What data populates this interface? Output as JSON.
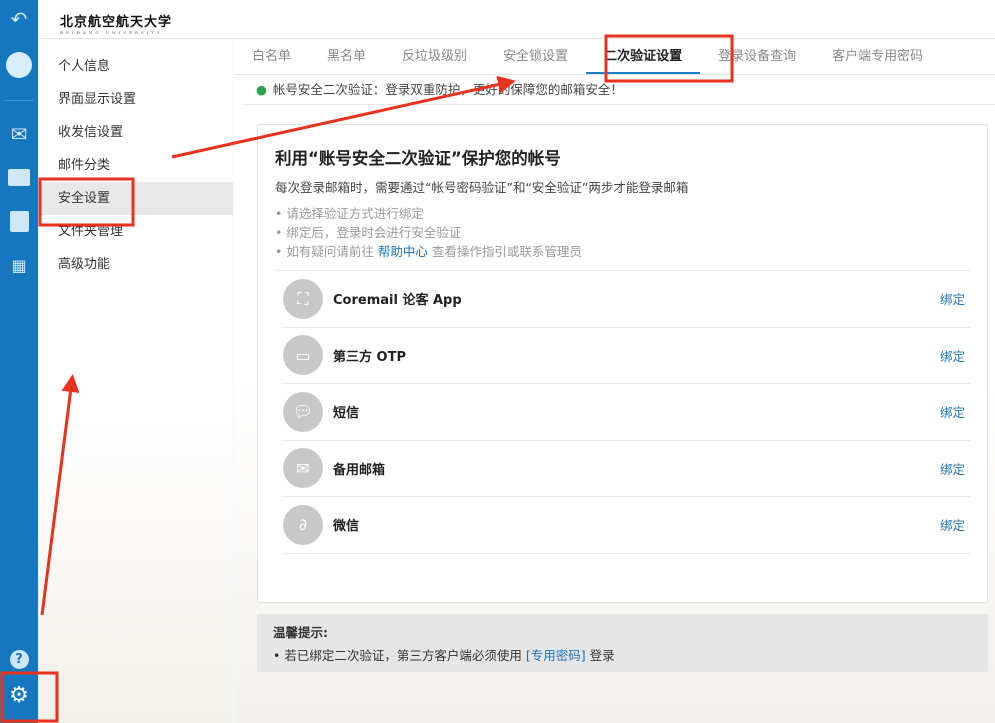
{
  "logo": {
    "text": "北京航空航天大学",
    "sub": "BEIHANG UNIVERSITY"
  },
  "rail": {
    "icons": [
      "back-icon",
      "avatar-icon",
      "mail-icon",
      "folder-icon",
      "contacts-icon",
      "apps-icon",
      "help-icon",
      "settings-icon"
    ]
  },
  "sidebar": {
    "items": [
      {
        "label": "个人信息"
      },
      {
        "label": "界面显示设置"
      },
      {
        "label": "收发信设置"
      },
      {
        "label": "邮件分类"
      },
      {
        "label": "安全设置"
      },
      {
        "label": "文件夹管理"
      },
      {
        "label": "高级功能"
      }
    ]
  },
  "tabs": [
    {
      "label": "白名单"
    },
    {
      "label": "黑名单"
    },
    {
      "label": "反垃圾级别"
    },
    {
      "label": "安全锁设置"
    },
    {
      "label": "二次验证设置"
    },
    {
      "label": "登录设备查询"
    },
    {
      "label": "客户端专用密码"
    }
  ],
  "banner": "帐号安全二次验证：登录双重防护，更好的保障您的邮箱安全！",
  "card": {
    "title": "利用“账号安全二次验证”保护您的帐号",
    "desc": "每次登录邮箱时，需要通过“帐号密码验证”和“安全验证”两步才能登录邮箱",
    "hints": [
      "请选择验证方式进行绑定",
      "绑定后，登录时会进行安全验证"
    ],
    "hint3_pre": "如有疑问请前往",
    "hint3_link": "帮助中心",
    "hint3_post": "查看操作指引或联系管理员",
    "methods": [
      {
        "label": "Coremail 论客 App",
        "action": "绑定"
      },
      {
        "label": "第三方 OTP",
        "action": "绑定"
      },
      {
        "label": "短信",
        "action": "绑定"
      },
      {
        "label": "备用邮箱",
        "action": "绑定"
      },
      {
        "label": "微信",
        "action": "绑定"
      }
    ]
  },
  "tip": {
    "title": "温馨提示:",
    "pre": "若已绑定二次验证，第三方客户端必须使用",
    "link": "[专用密码]",
    "post": "登录"
  },
  "colors": {
    "rail": "#1577bd",
    "accent": "#1b73b8",
    "annotation": "#e8321e"
  }
}
